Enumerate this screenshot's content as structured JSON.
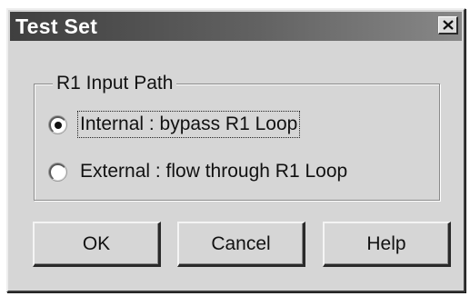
{
  "window": {
    "title": "Test Set",
    "close_symbol": "×",
    "close_icon": "close-icon"
  },
  "group": {
    "legend": "R1 Input Path",
    "options": [
      {
        "label": "Internal  : bypass R1 Loop",
        "selected": true,
        "focused": true
      },
      {
        "label": "External : flow through R1 Loop",
        "selected": false,
        "focused": false
      }
    ]
  },
  "buttons": {
    "ok": "OK",
    "cancel": "Cancel",
    "help": "Help"
  }
}
